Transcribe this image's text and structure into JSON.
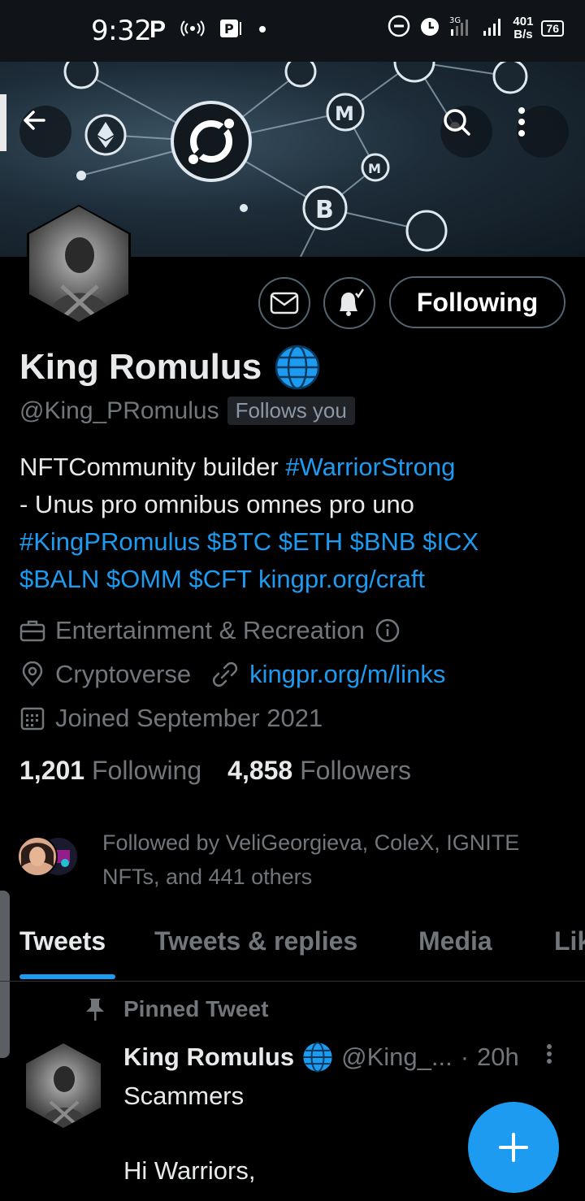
{
  "status_bar": {
    "time": "9:32",
    "carrier_badge": "P",
    "network_speed_value": "401",
    "network_speed_unit": "B/s",
    "battery": "76",
    "icons": [
      "hotspot-icon",
      "parking-app-icon",
      "dot-icon",
      "do-not-disturb-icon",
      "alarm-icon",
      "signal-4g-icon",
      "signal-bars-icon"
    ]
  },
  "header": {
    "back_icon": "arrow-left-icon",
    "search_icon": "search-icon",
    "more_icon": "more-vertical-icon"
  },
  "profile": {
    "name": "King Romulus",
    "verified_icon": "globe-icon",
    "handle": "@King_PRomulus",
    "follows_you": "Follows you",
    "follow_button": "Following",
    "bio": {
      "t1": "NFTCommunity builder ",
      "l1": "#WarriorStrong",
      "t2": "- Unus pro omnibus omnes pro uno",
      "l2": "#KingPRomulus $BTC $ETH $BNB $ICX",
      "l3": "$BALN $OMM $CFT kingpr.org/craft"
    },
    "category": "Entertainment & Recreation",
    "location": "Cryptoverse",
    "website": "kingpr.org/m/links",
    "joined": "Joined September 2021",
    "following_count": "1,201",
    "following_label": "Following",
    "followers_count": "4,858",
    "followers_label": "Followers",
    "followed_by": "Followed by VeliGeorgieva, ColeX, IGNITE NFTs, and 441 others"
  },
  "tabs": [
    {
      "label": "Tweets",
      "active": true
    },
    {
      "label": "Tweets & replies",
      "active": false
    },
    {
      "label": "Media",
      "active": false
    },
    {
      "label": "Lik",
      "active": false
    }
  ],
  "pinned_tweet": {
    "pinned_label": "Pinned Tweet",
    "author_name": "King Romulus",
    "author_handle": "@King_...",
    "separator": "·",
    "time": "20h",
    "body": "Scammers\n\nHi Warriors,"
  },
  "colors": {
    "accent": "#1d9bf0",
    "secondary_text": "#71767b",
    "background": "#000000"
  }
}
